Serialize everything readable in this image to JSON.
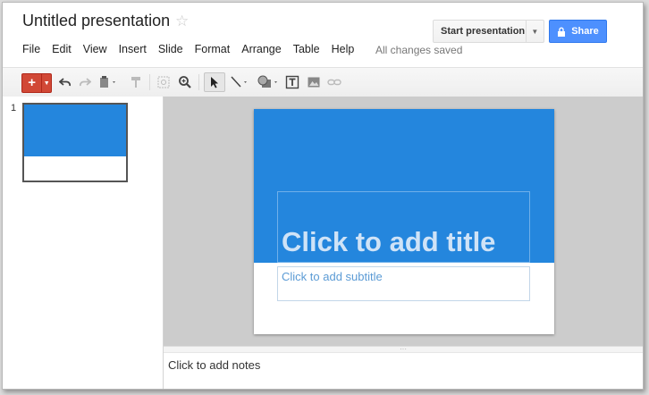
{
  "header": {
    "doc_title": "Untitled presentation",
    "star_icon": "star-icon",
    "save_status": "All changes saved",
    "start_presentation_label": "Start presentation",
    "share_label": "Share"
  },
  "menu": {
    "items": [
      "File",
      "Edit",
      "View",
      "Insert",
      "Slide",
      "Format",
      "Arrange",
      "Table",
      "Help"
    ]
  },
  "toolbar": {
    "new_icon": "plus-icon",
    "tools": [
      "undo-icon",
      "redo-icon",
      "paste-icon",
      "paint-format-icon",
      "zoom-fit-icon",
      "zoom-icon",
      "select-icon",
      "line-icon",
      "shape-icon",
      "text-box-icon",
      "image-icon",
      "link-icon"
    ]
  },
  "filmstrip": {
    "slides": [
      {
        "number": "1"
      }
    ]
  },
  "slide": {
    "title_placeholder": "Click to add title",
    "subtitle_placeholder": "Click to add subtitle"
  },
  "notes": {
    "placeholder": "Click to add notes",
    "handle": "···"
  },
  "colors": {
    "accent_blue": "#2486dd",
    "share_blue": "#4d90fe",
    "new_red": "#d14836"
  }
}
